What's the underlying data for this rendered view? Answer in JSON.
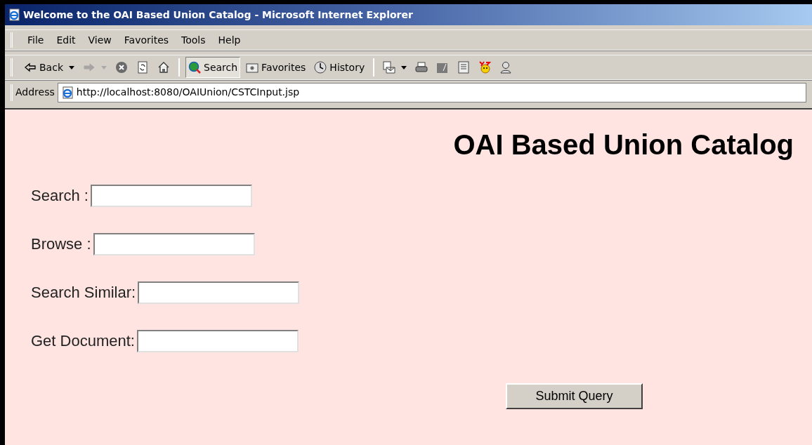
{
  "window": {
    "title": "Welcome to the OAI Based Union Catalog - Microsoft Internet Explorer"
  },
  "menu": [
    "File",
    "Edit",
    "View",
    "Favorites",
    "Tools",
    "Help"
  ],
  "toolbar": [
    {
      "kind": "back",
      "label": "Back",
      "disabled": false,
      "pressed": false
    },
    {
      "kind": "forward",
      "disabled": true,
      "pressed": false
    },
    {
      "kind": "stop",
      "disabled": false,
      "pressed": false
    },
    {
      "kind": "refresh",
      "disabled": false,
      "pressed": false
    },
    {
      "kind": "home",
      "disabled": false,
      "pressed": false
    },
    {
      "kind": "search",
      "label": "Search",
      "disabled": false,
      "pressed": true
    },
    {
      "kind": "favorites",
      "label": "Favorites",
      "disabled": false,
      "pressed": false
    },
    {
      "kind": "history",
      "label": "History",
      "disabled": false,
      "pressed": false
    },
    {
      "kind": "mail",
      "disabled": false,
      "pressed": false
    },
    {
      "kind": "print",
      "disabled": false,
      "pressed": false
    },
    {
      "kind": "edit",
      "disabled": false,
      "pressed": false
    },
    {
      "kind": "discuss",
      "disabled": false,
      "pressed": false
    },
    {
      "kind": "messenger",
      "disabled": false,
      "pressed": false
    },
    {
      "kind": "contact",
      "disabled": false,
      "pressed": false
    }
  ],
  "address": {
    "label": "Address",
    "url": "http://localhost:8080/OAIUnion/CSTCInput.jsp"
  },
  "page": {
    "heading": "OAI Based Union Catalog",
    "fields": [
      {
        "label": "Search :"
      },
      {
        "label": "Browse :"
      },
      {
        "label": "Search Similar:"
      },
      {
        "label": "Get Document:"
      }
    ],
    "submit": "Submit Query"
  }
}
